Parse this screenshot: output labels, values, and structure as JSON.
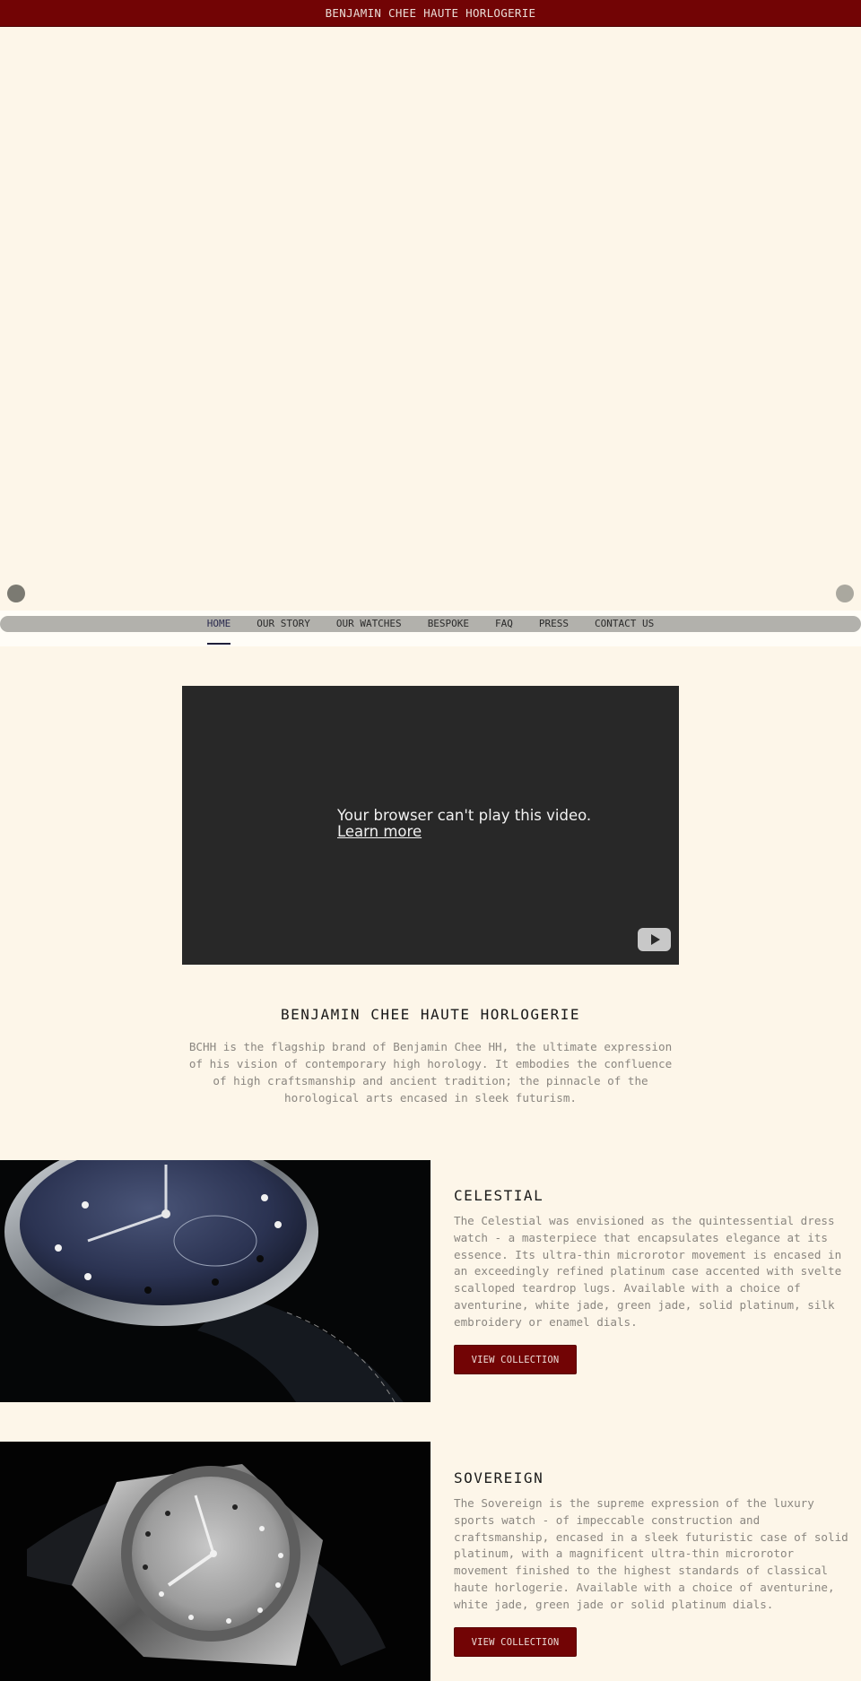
{
  "header": {
    "brand_title": "BENJAMIN CHEE HAUTE HORLOGERIE"
  },
  "carousel": {
    "prev_label": "previous slide",
    "next_label": "next slide"
  },
  "nav": {
    "items": [
      {
        "label": "HOME",
        "active": true
      },
      {
        "label": "OUR STORY",
        "active": false
      },
      {
        "label": "OUR WATCHES",
        "active": false
      },
      {
        "label": "BESPOKE",
        "active": false
      },
      {
        "label": "FAQ",
        "active": false
      },
      {
        "label": "PRESS",
        "active": false
      },
      {
        "label": "CONTACT US",
        "active": false
      }
    ]
  },
  "video": {
    "message": "Your browser can't play this video.",
    "link_label": "Learn more",
    "play_icon": "youtube-play-icon"
  },
  "intro": {
    "title": "BENJAMIN CHEE HAUTE HORLOGERIE",
    "text": "BCHH is the flagship brand of Benjamin Chee HH, the ultimate expression of his vision of contemporary high horology. It embodies the confluence of high craftsmanship and ancient tradition; the pinnacle of the horological arts encased in sleek futurism."
  },
  "features": [
    {
      "title": "CELESTIAL",
      "text": "The Celestial was envisioned as the quintessential dress watch - a masterpiece that encapsulates elegance at its essence. Its ultra-thin microrotor movement is encased in an exceedingly refined platinum case accented with svelte scalloped teardrop lugs. Available with a choice of aventurine, white jade, green jade, solid platinum, silk embroidery or enamel dials.",
      "button_label": "VIEW COLLECTION",
      "image_alt": "Celestial watch with aventurine dial"
    },
    {
      "title": "SOVEREIGN",
      "text": "The Sovereign is the supreme expression of the luxury sports watch - of impeccable construction and craftsmanship, encased in a sleek futuristic case of solid platinum, with a magnificent ultra-thin microrotor movement finished to the highest standards of classical haute horlogerie. Available with a choice of aventurine, white jade, green jade or solid platinum dials.",
      "button_label": "VIEW COLLECTION",
      "image_alt": "Sovereign watch with guilloché platinum dial"
    }
  ],
  "colors": {
    "brand": "#720405",
    "background": "#fdf6e9",
    "nav_bar": "#b2b1ac",
    "video_bg": "#282828"
  }
}
